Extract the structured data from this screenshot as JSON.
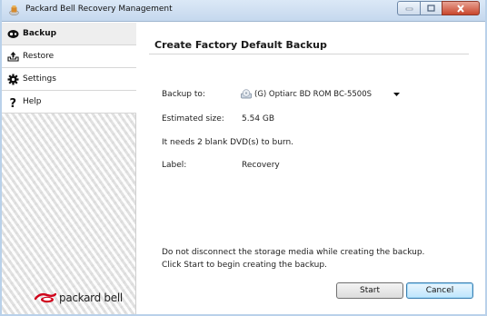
{
  "window": {
    "title": "Packard Bell Recovery Management"
  },
  "sidebar": {
    "items": [
      {
        "label": "Backup",
        "icon": "backup-icon",
        "active": true
      },
      {
        "label": "Restore",
        "icon": "restore-icon",
        "active": false
      },
      {
        "label": "Settings",
        "icon": "gear-icon",
        "active": false
      },
      {
        "label": "Help",
        "icon": "help-icon",
        "active": false
      }
    ],
    "brand": "packard bell"
  },
  "main": {
    "title": "Create Factory Default Backup",
    "backup_to_label": "Backup to:",
    "backup_to_value": "(G) Optiarc  BD ROM BC-5500S",
    "estimated_size_label": "Estimated size:",
    "estimated_size_value": "5.54 GB",
    "dvd_note": "It needs 2 blank DVD(s) to burn.",
    "label_label": "Label:",
    "label_value": "Recovery",
    "instruction_1": "Do not disconnect the storage media while creating the backup.",
    "instruction_2": "Click Start to begin creating the backup.",
    "start_button": "Start",
    "cancel_button": "Cancel"
  },
  "colors": {
    "brand_red": "#d0021b",
    "title_bar": "#c5d8ee",
    "close_button": "#c9462c"
  }
}
